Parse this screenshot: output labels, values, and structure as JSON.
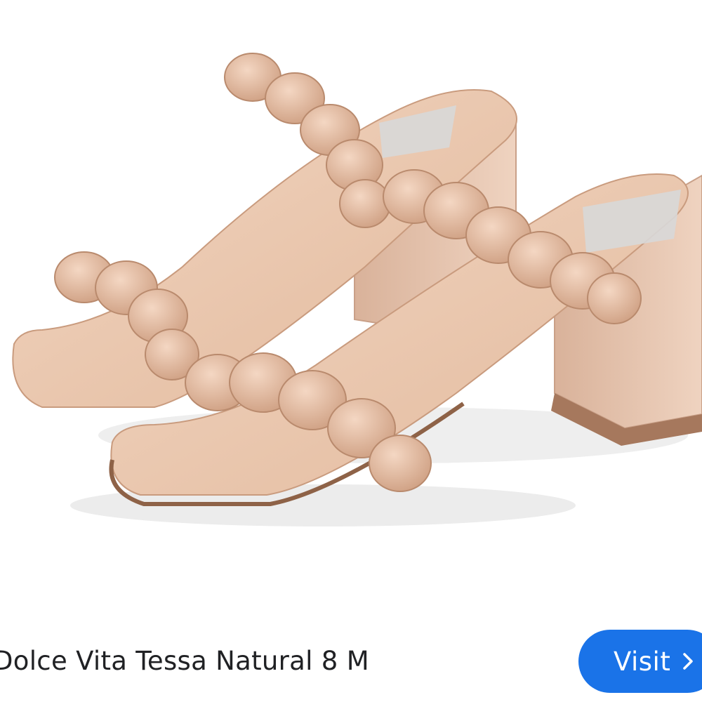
{
  "product": {
    "title": "Dolce Vita Tessa Natural 8 M",
    "image_icon": "braided-sandal-product-photo"
  },
  "actions": {
    "visit_label": "Visit",
    "visit_icon": "chevron-right-icon"
  },
  "colors": {
    "visit_button": "#1a73e8",
    "sandal_tan": "#e8c3a8",
    "sandal_shadow": "#c99b7e"
  }
}
